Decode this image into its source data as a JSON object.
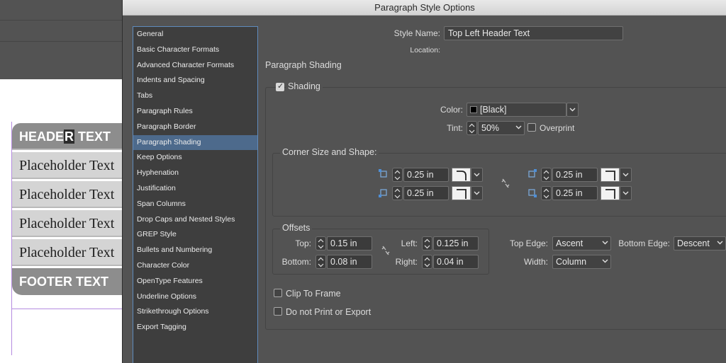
{
  "background": {
    "samples": [
      {
        "type": "header",
        "before": "HEADE",
        "highlight": "R",
        "after": " TEXT"
      },
      {
        "type": "body",
        "text": "Placeholder Text"
      },
      {
        "type": "body",
        "text": "Placeholder Text"
      },
      {
        "type": "body",
        "text": "Placeholder Text"
      },
      {
        "type": "body",
        "text": "Placeholder Text"
      },
      {
        "type": "footer",
        "text": "FOOTER TEXT"
      }
    ]
  },
  "dialog": {
    "title": "Paragraph Style Options",
    "categories": [
      "General",
      "Basic Character Formats",
      "Advanced Character Formats",
      "Indents and Spacing",
      "Tabs",
      "Paragraph Rules",
      "Paragraph Border",
      "Paragraph Shading",
      "Keep Options",
      "Hyphenation",
      "Justification",
      "Span Columns",
      "Drop Caps and Nested Styles",
      "GREP Style",
      "Bullets and Numbering",
      "Character Color",
      "OpenType Features",
      "Underline Options",
      "Strikethrough Options",
      "Export Tagging"
    ],
    "selected_category": "Paragraph Shading",
    "style_name_label": "Style Name:",
    "style_name_value": "Top Left Header Text",
    "location_label": "Location:",
    "section_title": "Paragraph Shading",
    "shading": {
      "label": "Shading",
      "checked": true,
      "color_label": "Color:",
      "color_value": "[Black]",
      "tint_label": "Tint:",
      "tint_value": "50%",
      "overprint_label": "Overprint",
      "overprint_checked": false
    },
    "corner": {
      "title": "Corner Size and Shape:",
      "top_left": "0.25 in",
      "bottom_left": "0.25 in",
      "top_right": "0.25 in",
      "bottom_right": "0.25 in"
    },
    "offsets": {
      "title": "Offsets",
      "top_label": "Top:",
      "top_value": "0.15 in",
      "bottom_label": "Bottom:",
      "bottom_value": "0.08 in",
      "left_label": "Left:",
      "left_value": "0.125 in",
      "right_label": "Right:",
      "right_value": "0.04 in"
    },
    "edges": {
      "top_edge_label": "Top Edge:",
      "top_edge_value": "Ascent",
      "bottom_edge_label": "Bottom Edge:",
      "bottom_edge_value": "Descent",
      "width_label": "Width:",
      "width_value": "Column"
    },
    "clip_to_frame": {
      "label": "Clip To Frame",
      "checked": false
    },
    "do_not_print": {
      "label": "Do not Print or Export",
      "checked": false
    }
  }
}
